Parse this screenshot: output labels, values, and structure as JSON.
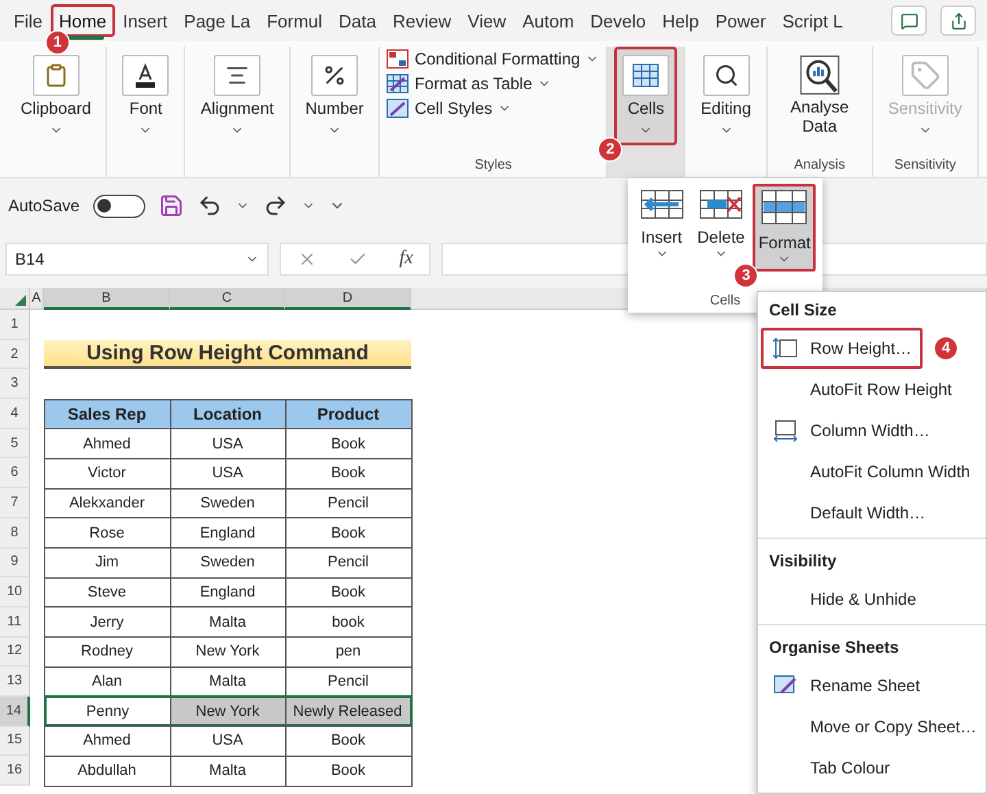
{
  "menu_tabs": [
    {
      "label": "File",
      "selected": false,
      "highlighted": false
    },
    {
      "label": "Home",
      "selected": true,
      "highlighted": true,
      "step": "1"
    },
    {
      "label": "Insert",
      "selected": false,
      "highlighted": false
    },
    {
      "label": "Page La",
      "selected": false,
      "highlighted": false
    },
    {
      "label": "Formul",
      "selected": false,
      "highlighted": false
    },
    {
      "label": "Data",
      "selected": false,
      "highlighted": false
    },
    {
      "label": "Review",
      "selected": false,
      "highlighted": false
    },
    {
      "label": "View",
      "selected": false,
      "highlighted": false
    },
    {
      "label": "Autom",
      "selected": false,
      "highlighted": false
    },
    {
      "label": "Develo",
      "selected": false,
      "highlighted": false
    },
    {
      "label": "Help",
      "selected": false,
      "highlighted": false
    },
    {
      "label": "Power",
      "selected": false,
      "highlighted": false
    },
    {
      "label": "Script L",
      "selected": false,
      "highlighted": false
    }
  ],
  "ribbon": [
    {
      "kind": "button",
      "label": "Clipboard",
      "highlighted": false,
      "disabled": false
    },
    {
      "kind": "button",
      "label": "Font",
      "highlighted": false,
      "disabled": false
    },
    {
      "kind": "button",
      "label": "Alignment",
      "highlighted": false,
      "disabled": false
    },
    {
      "kind": "button",
      "label": "Number",
      "highlighted": false,
      "disabled": false
    },
    {
      "kind": "styles",
      "group_label": "Styles",
      "items": [
        "Conditional Formatting",
        "Format as Table",
        "Cell Styles"
      ]
    },
    {
      "kind": "button",
      "label": "Cells",
      "highlighted": true,
      "disabled": false,
      "step": "2"
    },
    {
      "kind": "button",
      "label": "Editing",
      "highlighted": false,
      "disabled": false
    },
    {
      "kind": "button",
      "label": "Analyse Data",
      "group_label": "Analysis",
      "highlighted": false,
      "disabled": false
    },
    {
      "kind": "button",
      "label": "Sensitivity",
      "group_label": "Sensitivity",
      "highlighted": false,
      "disabled": true
    }
  ],
  "quick_access": {
    "autosave_label": "AutoSave",
    "autosave_on": false
  },
  "formula_bar": {
    "name_box": "B14",
    "function_label": "fx"
  },
  "cells_dropdown": {
    "group_label": "Cells",
    "buttons": [
      {
        "label": "Insert",
        "highlighted": false
      },
      {
        "label": "Delete",
        "highlighted": false
      },
      {
        "label": "Format",
        "highlighted": true,
        "step": "3"
      }
    ]
  },
  "sheet": {
    "columns": [
      {
        "label": "A",
        "selected": false
      },
      {
        "label": "B",
        "selected": true
      },
      {
        "label": "C",
        "selected": true
      },
      {
        "label": "D",
        "selected": true
      }
    ],
    "rows": [
      {
        "number": "1",
        "kind": "blank",
        "selected": false
      },
      {
        "number": "2",
        "kind": "title",
        "selected": false,
        "title": "Using Row Height Command"
      },
      {
        "number": "3",
        "kind": "blank",
        "selected": false
      },
      {
        "number": "4",
        "kind": "header",
        "selected": false,
        "cells": [
          "Sales Rep",
          "Location",
          "Product"
        ]
      },
      {
        "number": "5",
        "kind": "data",
        "selected": false,
        "cells": [
          "Ahmed",
          "USA",
          "Book"
        ]
      },
      {
        "number": "6",
        "kind": "data",
        "selected": false,
        "cells": [
          "Victor",
          "USA",
          "Book"
        ]
      },
      {
        "number": "7",
        "kind": "data",
        "selected": false,
        "cells": [
          "Alekxander",
          "Sweden",
          "Pencil"
        ]
      },
      {
        "number": "8",
        "kind": "data",
        "selected": false,
        "cells": [
          "Rose",
          "England",
          "Book"
        ]
      },
      {
        "number": "9",
        "kind": "data",
        "selected": false,
        "cells": [
          "Jim",
          "Sweden",
          "Pencil"
        ]
      },
      {
        "number": "10",
        "kind": "data",
        "selected": false,
        "cells": [
          "Steve",
          "England",
          "Book"
        ]
      },
      {
        "number": "11",
        "kind": "data",
        "selected": false,
        "cells": [
          "Jerry",
          "Malta",
          "book"
        ]
      },
      {
        "number": "12",
        "kind": "data",
        "selected": false,
        "cells": [
          "Rodney",
          "New York",
          "pen"
        ]
      },
      {
        "number": "13",
        "kind": "data",
        "selected": false,
        "cells": [
          "Alan",
          "Malta",
          "Pencil"
        ]
      },
      {
        "number": "14",
        "kind": "data",
        "selected": true,
        "cells": [
          "Penny",
          "New York",
          "Newly Released"
        ]
      },
      {
        "number": "15",
        "kind": "data",
        "selected": false,
        "cells": [
          "Ahmed",
          "USA",
          "Book"
        ]
      },
      {
        "number": "16",
        "kind": "data",
        "selected": false,
        "cells": [
          "Abdullah",
          "Malta",
          "Book"
        ]
      }
    ]
  },
  "format_menu": {
    "sections": [
      {
        "heading": "Cell Size",
        "items": [
          {
            "label": "Row Height…",
            "highlighted": true,
            "step": "4"
          },
          {
            "label": "AutoFit Row Height",
            "highlighted": false
          },
          {
            "label": "Column Width…",
            "highlighted": false
          },
          {
            "label": "AutoFit Column Width",
            "highlighted": false
          },
          {
            "label": "Default Width…",
            "highlighted": false
          }
        ]
      },
      {
        "heading": "Visibility",
        "items": [
          {
            "label": "Hide & Unhide",
            "highlighted": false
          }
        ]
      },
      {
        "heading": "Organise Sheets",
        "items": [
          {
            "label": "Rename Sheet",
            "highlighted": false
          },
          {
            "label": "Move or Copy Sheet…",
            "highlighted": false
          },
          {
            "label": "Tab Colour",
            "highlighted": false
          }
        ]
      }
    ]
  }
}
